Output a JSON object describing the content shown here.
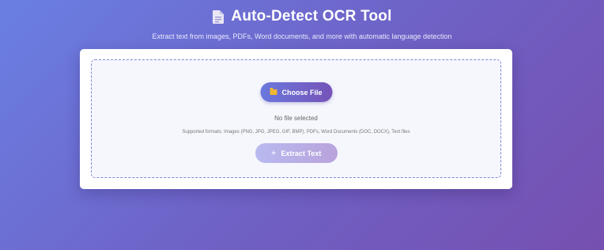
{
  "header": {
    "title": "Auto-Detect OCR Tool",
    "subtitle": "Extract text from images, PDFs, Word documents, and more with automatic language detection",
    "icon": "document-icon"
  },
  "upload": {
    "choose_button": "Choose File",
    "choose_icon": "folder-icon",
    "file_status": "No file selected",
    "supported_formats": "Supported formats: Images (PNG, JPG, JPEG, GIF, BMP), PDFs, Word Documents (DOC, DOCX), Text files",
    "extract_button": "Extract Text",
    "extract_icon": "sparkle-icon",
    "extract_enabled": false
  },
  "colors": {
    "background_start": "#6a7fe3",
    "background_end": "#7650b0",
    "button_start": "#6a78dd",
    "button_end": "#7653b8",
    "dropzone_border": "#7c86d6"
  }
}
